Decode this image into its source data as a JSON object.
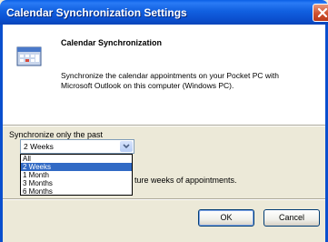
{
  "window": {
    "title": "Calendar Synchronization Settings",
    "close_icon": "close-x-icon"
  },
  "header": {
    "icon": "calendar-icon",
    "heading": "Calendar Synchronization",
    "description": "Synchronize the calendar appointments on your Pocket PC with Microsoft Outlook on this computer (Windows PC)."
  },
  "sync": {
    "label": "Synchronize only the past",
    "selected_value": "2 Weeks",
    "options": [
      "All",
      "2 Weeks",
      "1 Month",
      "3 Months",
      "6 Months"
    ],
    "selected_index": 1,
    "after_text": "ture weeks of appointments."
  },
  "buttons": {
    "ok_label": "OK",
    "cancel_label": "Cancel"
  },
  "colors": {
    "titlebar": "#0A5FE6",
    "selection": "#316AC5",
    "dialog_bg": "#ECE9D8",
    "close_button": "#D0512E"
  }
}
